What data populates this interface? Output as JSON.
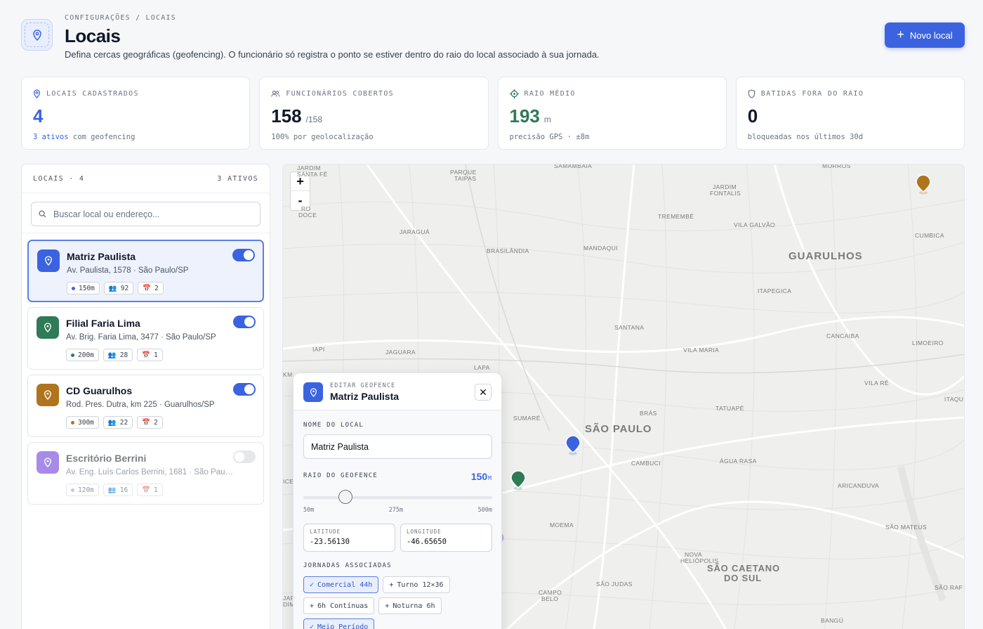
{
  "header": {
    "breadcrumb": "CONFIGURAÇÕES / LOCAIS",
    "title": "Locais",
    "description": "Defina cercas geográficas (geofencing). O funcionário só registra o ponto se estiver dentro do raio do local associado à sua jornada.",
    "new_button": "Novo local"
  },
  "stats": [
    {
      "label": "LOCAIS CADASTRADOS",
      "value": "4",
      "unit": "",
      "sub_accent": "3 ativos",
      "sub": " com geofencing",
      "color": "#3b63e0",
      "icon": "pin-icon"
    },
    {
      "label": "FUNCIONÁRIOS COBERTOS",
      "value": "158",
      "unit": "/158",
      "sub_accent": "",
      "sub": "100% por geolocalização",
      "color": "#111827",
      "icon": "users-icon"
    },
    {
      "label": "RAIO MÉDIO",
      "value": "193",
      "unit": "m",
      "sub_accent": "",
      "sub": "precisão GPS · ±8m",
      "color": "#2f7a57",
      "icon": "target-icon"
    },
    {
      "label": "BATIDAS FORA DO RAIO",
      "value": "0",
      "unit": "",
      "sub_accent": "",
      "sub": "bloqueadas nos últimos 30d",
      "color": "#111827",
      "icon": "shield-icon"
    }
  ],
  "sidebar": {
    "title": "LOCAIS · 4",
    "active_count": "3 ATIVOS",
    "search_placeholder": "Buscar local ou endereço...",
    "items": [
      {
        "name": "Matriz Paulista",
        "address": "Av. Paulista, 1578 · São Paulo/SP",
        "radius": "150m",
        "employees": "92",
        "schedules": "2",
        "color": "#3b63e0",
        "enabled": true
      },
      {
        "name": "Filial Faria Lima",
        "address": "Av. Brig. Faria Lima, 3477 · São Paulo/SP",
        "radius": "200m",
        "employees": "28",
        "schedules": "1",
        "color": "#2f7a57",
        "enabled": true
      },
      {
        "name": "CD Guarulhos",
        "address": "Rod. Pres. Dutra, km 225 · Guarulhos/SP",
        "radius": "300m",
        "employees": "22",
        "schedules": "2",
        "color": "#b0741e",
        "enabled": true
      },
      {
        "name": "Escritório Berrini",
        "address": "Av. Eng. Luís Carlos Berrini, 1681 · São Paulo/...",
        "radius": "120m",
        "employees": "16",
        "schedules": "1",
        "color": "#a78bea",
        "enabled": false
      }
    ]
  },
  "map": {
    "zoom_in": "+",
    "zoom_out": "-",
    "labels": {
      "guarulhos": "GUARULHOS",
      "sao_paulo": "SÃO PAULO",
      "sao_caetano_1": "SÃO CAETANO",
      "sao_caetano_2": "DO SUL",
      "jardim_santa_fe_1": "JARDIM",
      "jardim_santa_fe_2": "SANTA FÉ",
      "parque_taipas_1": "PARQUE",
      "parque_taipas_2": "TAIPAS",
      "samambaia": "SAMAMBAIA",
      "morros": "MORROS",
      "jardim_fontalis_1": "JARDIM",
      "jardim_fontalis_2": "FONTALIS",
      "tremembe": "TREMEMBÉ",
      "jaragua": "JARAGUÁ",
      "vila_galvao": "VILA GALVÃO",
      "cumbica": "CUMBICA",
      "brasilandia": "BRASILÂNDIA",
      "mandaqui": "MANDAQUI",
      "itapegica": "ITAPEGICA",
      "santana": "SANTANA",
      "cancaiba": "CANCAIBA",
      "limoeiro": "LIMOEIRO",
      "iapi": "IAPI",
      "jaguara": "JAGUARA",
      "vila_maria": "VILA MARIA",
      "lapa": "LAPA",
      "vila_re": "VILA RÉ",
      "itaquera": "ITAQUE",
      "tatuape": "TATUAPÉ",
      "bras": "BRÁS",
      "sumare": "SUMARÉ",
      "cambuci": "CAMBUCI",
      "agua_rasa": "ÁGUA RASA",
      "aricanduva": "ARICANDUVA",
      "moema": "MOEMA",
      "nova_heliopolis_1": "NOVA",
      "nova_heliopolis_2": "HELIÓPOLIS",
      "sao_mateus": "SÃO MATEUS",
      "sao_judas": "SÃO JUDAS",
      "campo_belo_1": "CAMPO",
      "campo_belo_2": "BELO",
      "bangu": "BANGÚ",
      "sao_raf": "SÃO RAF",
      "ouro_doce_1": "RO",
      "ouro_doce_2": "DOCE",
      "km": "KM",
      "ice": "ICE",
      "jar": "JAR",
      "dim": "DIM"
    }
  },
  "editor": {
    "kicker": "EDITAR GEOFENCE",
    "title": "Matriz Paulista",
    "close": "✕",
    "name_label": "NOME DO LOCAL",
    "name_value": "Matriz Paulista",
    "radius_label": "RAIO DO GEOFENCE",
    "radius_value": "150",
    "radius_unit": "M",
    "radius_fraction": 0.222,
    "slider_min": "50m",
    "slider_mid": "275m",
    "slider_max": "500m",
    "latitude_label": "LATITUDE",
    "latitude_value": "-23.56130",
    "longitude_label": "LONGITUDE",
    "longitude_value": "-46.65650",
    "schedules_label": "JORNADAS ASSOCIADAS",
    "schedules": [
      {
        "label": "Comercial 44h",
        "selected": true
      },
      {
        "label": "Turno 12×36",
        "selected": false
      },
      {
        "label": "6h Contínuas",
        "selected": false
      },
      {
        "label": "Noturna 6h",
        "selected": false
      },
      {
        "label": "Meio Período",
        "selected": true
      }
    ]
  }
}
